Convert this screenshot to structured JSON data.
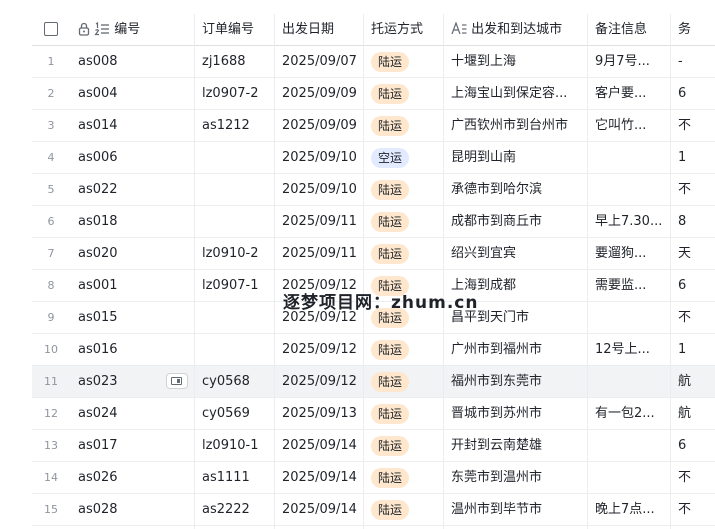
{
  "headers": {
    "num": "编号",
    "order": "订单编号",
    "date": "出发日期",
    "ship": "托运方式",
    "route": "出发和到达城市",
    "note": "备注信息",
    "extra": "务"
  },
  "rows": [
    {
      "idx": "1",
      "num": "as008",
      "order": "zj1688",
      "date": "2025/09/07",
      "ship": "陆运",
      "route": "十堰到上海",
      "note": "9月7号...",
      "extra": "-"
    },
    {
      "idx": "2",
      "num": "as004",
      "order": "lz0907-2",
      "date": "2025/09/09",
      "ship": "陆运",
      "route": "上海宝山到保定容...",
      "note": "客户要...",
      "extra": "6"
    },
    {
      "idx": "3",
      "num": "as014",
      "order": "as1212",
      "date": "2025/09/09",
      "ship": "陆运",
      "route": "广西钦州市到台州市",
      "note": "它叫竹...",
      "extra": "不"
    },
    {
      "idx": "4",
      "num": "as006",
      "order": "",
      "date": "2025/09/10",
      "ship": "空运",
      "route": "昆明到山南",
      "note": "",
      "extra": "1"
    },
    {
      "idx": "5",
      "num": "as022",
      "order": "",
      "date": "2025/09/10",
      "ship": "陆运",
      "route": "承德市到哈尔滨",
      "note": "",
      "extra": "不"
    },
    {
      "idx": "6",
      "num": "as018",
      "order": "",
      "date": "2025/09/11",
      "ship": "陆运",
      "route": "成都市到商丘市",
      "note": "早上7.30...",
      "extra": "8"
    },
    {
      "idx": "7",
      "num": "as020",
      "order": "lz0910-2",
      "date": "2025/09/11",
      "ship": "陆运",
      "route": "绍兴到宜宾",
      "note": "要遛狗...",
      "extra": "天"
    },
    {
      "idx": "8",
      "num": "as001",
      "order": "lz0907-1",
      "date": "2025/09/12",
      "ship": "陆运",
      "route": "上海到成都",
      "note": "需要监...",
      "extra": "6"
    },
    {
      "idx": "9",
      "num": "as015",
      "order": "",
      "date": "2025/09/12",
      "ship": "陆运",
      "route": "昌平到天门市",
      "note": "",
      "extra": "不"
    },
    {
      "idx": "10",
      "num": "as016",
      "order": "",
      "date": "2025/09/12",
      "ship": "陆运",
      "route": "广州市到福州市",
      "note": "12号上...",
      "extra": "1"
    },
    {
      "idx": "11",
      "num": "as023",
      "order": "cy0568",
      "date": "2025/09/12",
      "ship": "陆运",
      "route": "福州市到东莞市",
      "note": "",
      "extra": "航"
    },
    {
      "idx": "12",
      "num": "as024",
      "order": "cy0569",
      "date": "2025/09/13",
      "ship": "陆运",
      "route": "晋城市到苏州市",
      "note": "有一包2...",
      "extra": "航"
    },
    {
      "idx": "13",
      "num": "as017",
      "order": "lz0910-1",
      "date": "2025/09/14",
      "ship": "陆运",
      "route": "开封到云南楚雄",
      "note": "",
      "extra": "6"
    },
    {
      "idx": "14",
      "num": "as026",
      "order": "as1111",
      "date": "2025/09/14",
      "ship": "陆运",
      "route": "东莞市到温州市",
      "note": "",
      "extra": "不"
    },
    {
      "idx": "15",
      "num": "as028",
      "order": "as2222",
      "date": "2025/09/14",
      "ship": "陆运",
      "route": "温州市到毕节市",
      "note": "晚上7点...",
      "extra": "不"
    }
  ],
  "watermark": "逐梦项目网：zhum.cn",
  "colors": {
    "land_tag": "#fee7cd",
    "air_tag": "#e1eaff",
    "highlight_row": "#f2f3f5"
  }
}
